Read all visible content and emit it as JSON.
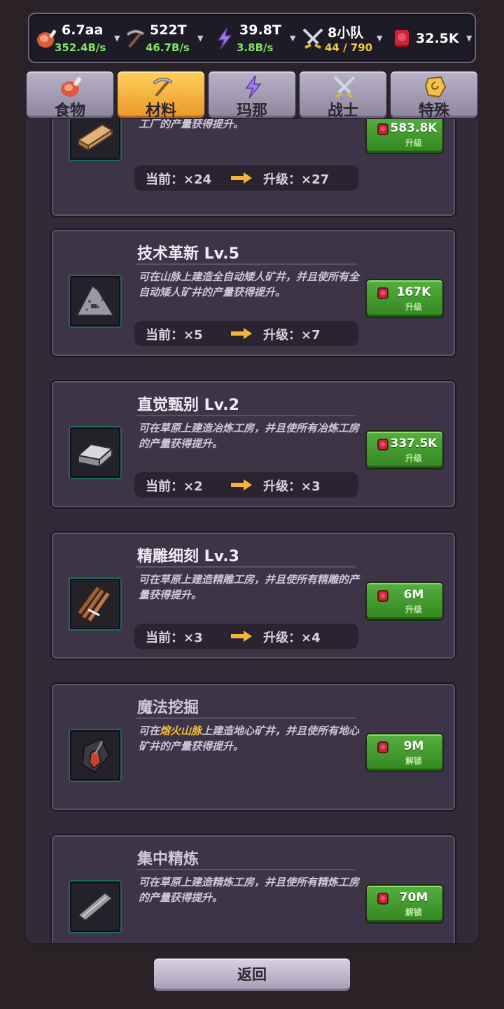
{
  "resources": [
    {
      "icon": "meat-icon",
      "value": "6.7aa",
      "rate": "352.4B/s"
    },
    {
      "icon": "pickaxe-icon",
      "value": "522T",
      "rate": "46.7B/s"
    },
    {
      "icon": "lightning-icon",
      "value": "39.8T",
      "rate": "3.8B/s"
    },
    {
      "icon": "crossed-swords-icon",
      "value": "8小队",
      "rate": "44 / 790"
    },
    {
      "icon": "gem-icon",
      "value": "32.5K"
    }
  ],
  "tabs": [
    {
      "label": "食物",
      "icon": "meat-icon",
      "active": false
    },
    {
      "label": "材料",
      "icon": "pickaxe-icon",
      "active": true
    },
    {
      "label": "玛那",
      "icon": "lightning-icon",
      "active": false
    },
    {
      "label": "战士",
      "icon": "crossed-swords-icon",
      "active": false
    },
    {
      "label": "特殊",
      "icon": "rune-stone-icon",
      "active": false
    }
  ],
  "cards": [
    {
      "title": "",
      "icon": "wood-plank-icon",
      "description": "可在草原上建造木材加工厂，并且使所有木材加工厂的产量获得提升。",
      "cost": "583.8K",
      "action": "升级",
      "current": "当前：×24",
      "next": "升级：×27"
    },
    {
      "title": "技术革新 Lv.5",
      "icon": "ore-pile-icon",
      "description": "可在山脉上建造全自动矮人矿井，并且使所有全自动矮人矿井的产量获得提升。",
      "cost": "167K",
      "action": "升级",
      "current": "当前：×5",
      "next": "升级：×7"
    },
    {
      "title": "直觉甄别 Lv.2",
      "icon": "iron-ingot-icon",
      "description": "可在草原上建造冶炼工房，并且使所有冶炼工房的产量获得提升。",
      "cost": "337.5K",
      "action": "升级",
      "current": "当前：×2",
      "next": "升级：×3"
    },
    {
      "title": "精雕细刻 Lv.3",
      "icon": "log-bundle-icon",
      "description": "可在草原上建造精雕工房，并且使所有精雕的产量获得提升。",
      "cost": "6M",
      "action": "升级",
      "current": "当前：×3",
      "next": "升级：×4"
    },
    {
      "title": "魔法挖掘",
      "icon": "magic-shovel-icon",
      "description_prefix": "可在",
      "description_highlight": "熔火山脉",
      "description_suffix": "上建造地心矿井，并且使所有地心矿井的产量获得提升。",
      "cost": "9M",
      "action": "解锁"
    },
    {
      "title": "集中精炼",
      "icon": "steel-bar-icon",
      "description": "可在草原上建造精炼工房，并且使所有精炼工房的产量获得提升。",
      "cost": "70M",
      "action": "解锁"
    }
  ],
  "back_label": "返回",
  "colors": {
    "accent_green": "#3f9a2b",
    "active_tab": "#f0a935",
    "rate_green": "#7fe36a",
    "highlight": "#f3bd3b"
  }
}
